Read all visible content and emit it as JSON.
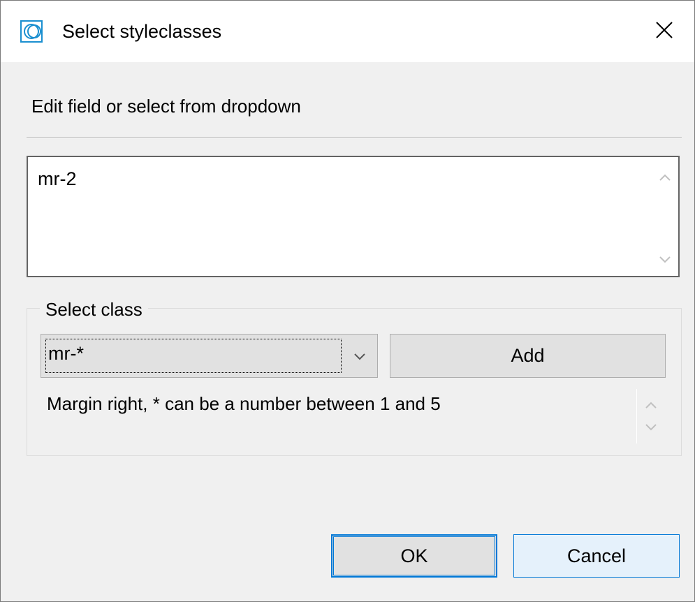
{
  "window": {
    "title": "Select styleclasses",
    "icon": "app-logo-icon",
    "close_icon": "close-icon",
    "accent_color": "#0078d7"
  },
  "instruction": "Edit field or select from dropdown",
  "styleclasses_field": {
    "value": "mr-2"
  },
  "select_class_group": {
    "legend": "Select class",
    "dropdown_value": "mr-*",
    "add_label": "Add",
    "description": "Margin right, * can be a number between 1 and 5"
  },
  "buttons": {
    "ok_label": "OK",
    "cancel_label": "Cancel"
  }
}
